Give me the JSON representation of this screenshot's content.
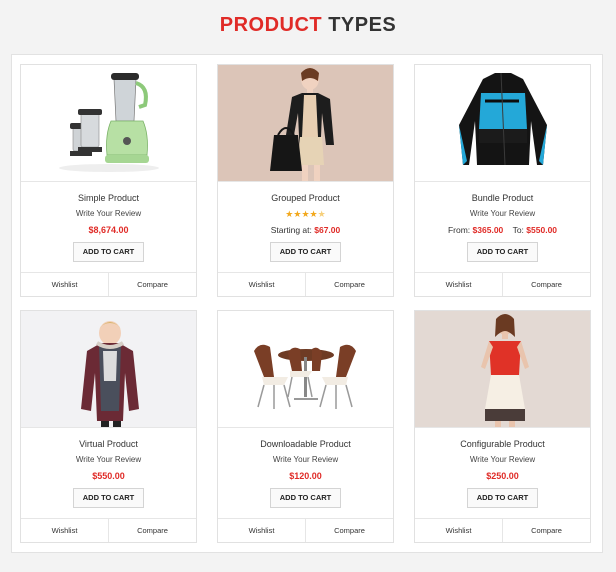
{
  "heading": {
    "accent": "PRODUCT",
    "rest": "TYPES"
  },
  "colors": {
    "accent": "#e02b27",
    "stars": "#f2a81d"
  },
  "products": [
    {
      "name": "Simple Product",
      "review": "Write Your Review",
      "price": "$8,674.00",
      "add_to_cart": "ADD TO CART",
      "wishlist": "Wishlist",
      "compare": "Compare",
      "image": "mixer-grinder"
    },
    {
      "name": "Grouped Product",
      "rating": "4.5 of 5",
      "price_label": "Starting at:",
      "price": "$67.00",
      "add_to_cart": "ADD TO CART",
      "wishlist": "Wishlist",
      "compare": "Compare",
      "image": "woman-with-handbag"
    },
    {
      "name": "Bundle Product",
      "review": "Write Your Review",
      "from_label": "From:",
      "from_price": "$365.00",
      "to_label": "To:",
      "to_price": "$550.00",
      "add_to_cart": "ADD TO CART",
      "wishlist": "Wishlist",
      "compare": "Compare",
      "image": "cycling-jacket"
    },
    {
      "name": "Virtual Product",
      "review": "Write Your Review",
      "price": "$550.00",
      "add_to_cart": "ADD TO CART",
      "wishlist": "Wishlist",
      "compare": "Compare",
      "image": "child-in-jacket"
    },
    {
      "name": "Downloadable Product",
      "review": "Write Your Review",
      "price": "$120.00",
      "add_to_cart": "ADD TO CART",
      "wishlist": "Wishlist",
      "compare": "Compare",
      "image": "dining-table-chairs"
    },
    {
      "name": "Configurable Product",
      "review": "Write Your Review",
      "price": "$250.00",
      "add_to_cart": "ADD TO CART",
      "wishlist": "Wishlist",
      "compare": "Compare",
      "image": "red-dress"
    }
  ]
}
